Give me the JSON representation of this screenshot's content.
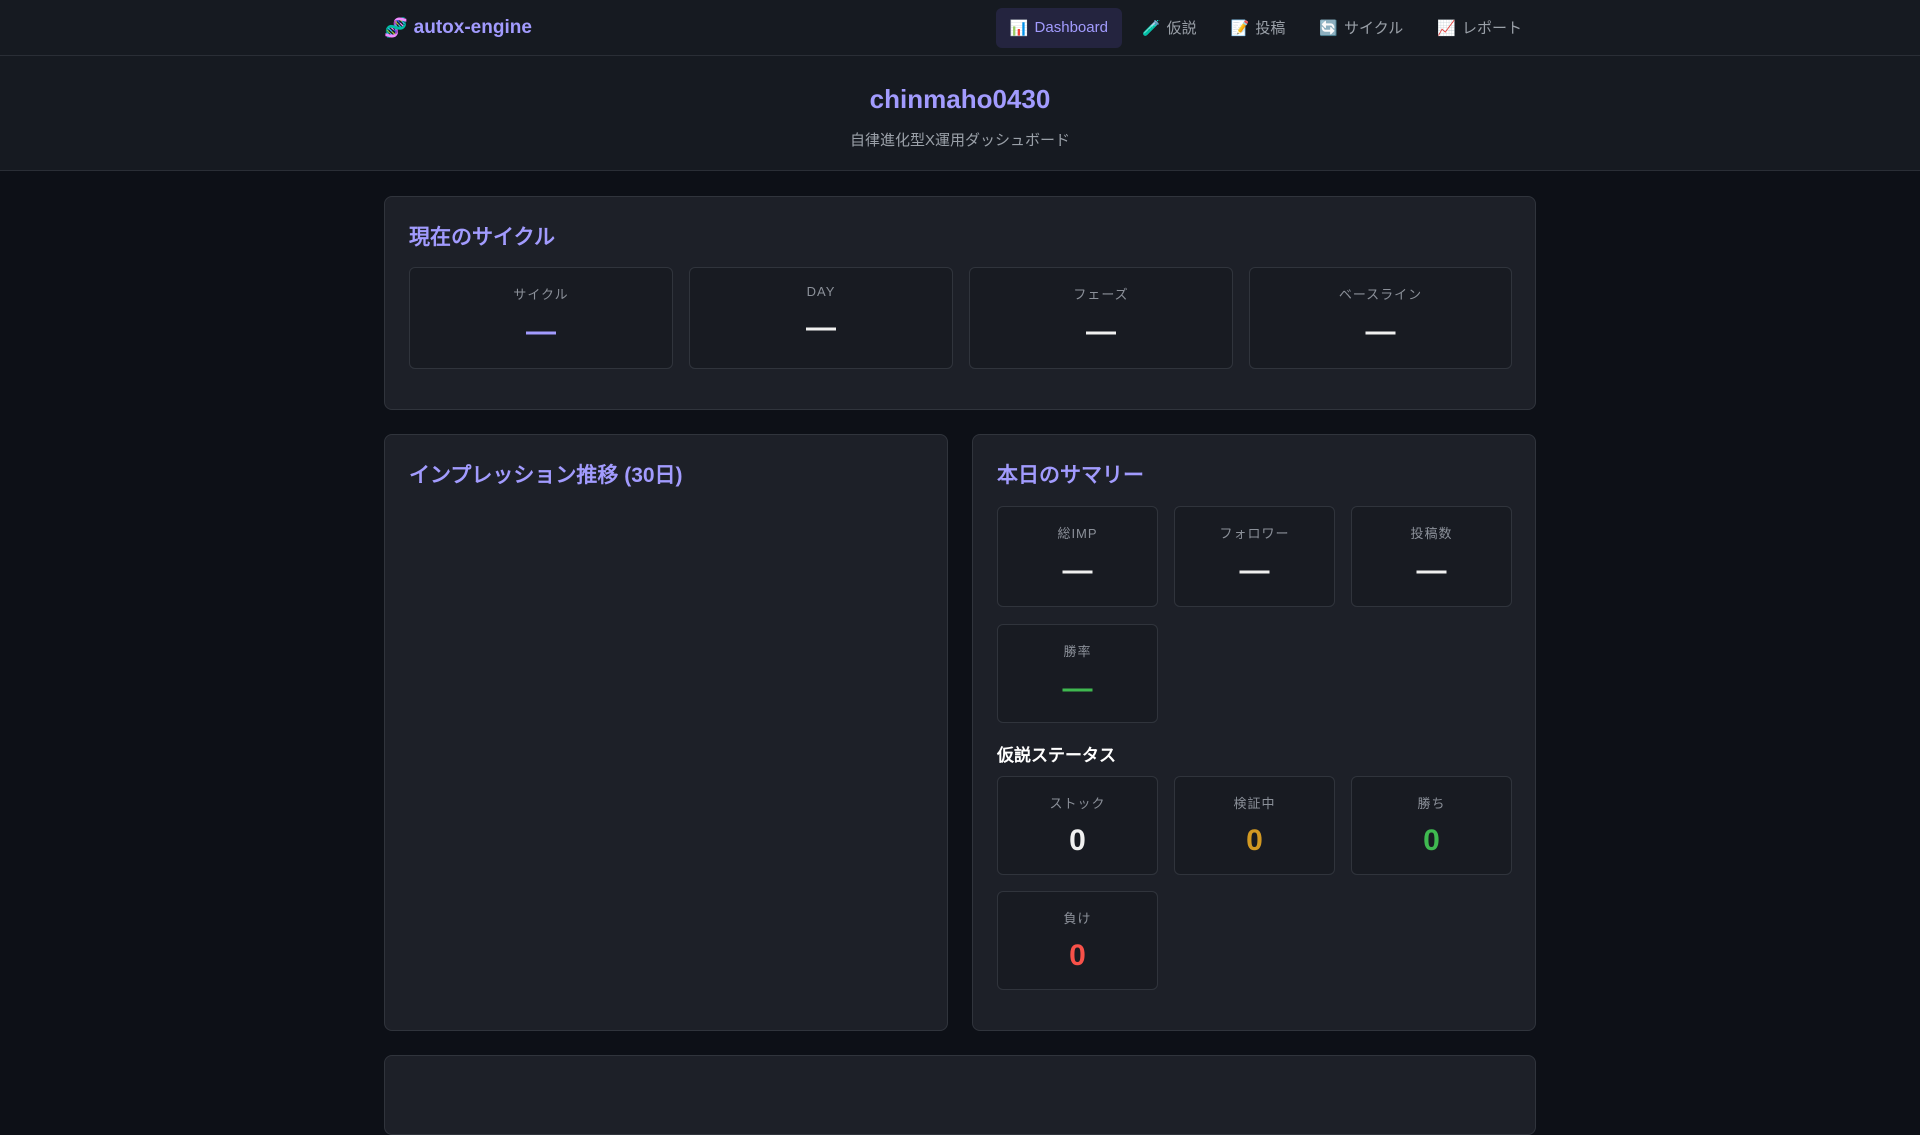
{
  "nav": {
    "logo": "autox-engine",
    "links": [
      {
        "icon": "📊",
        "label": "Dashboard"
      },
      {
        "icon": "🧪",
        "label": "仮説"
      },
      {
        "icon": "📝",
        "label": "投稿"
      },
      {
        "icon": "🔄",
        "label": "サイクル"
      },
      {
        "icon": "📈",
        "label": "レポート"
      }
    ]
  },
  "header": {
    "title": "chinmaho0430",
    "subtitle": "自律進化型X運用ダッシュボード"
  },
  "cycle": {
    "title": "現在のサイクル",
    "items": [
      {
        "label": "サイクル",
        "value": "—"
      },
      {
        "label": "DAY",
        "value": "—"
      },
      {
        "label": "フェーズ",
        "value": "—"
      },
      {
        "label": "ベースライン",
        "value": "—"
      }
    ]
  },
  "impressions": {
    "title": "インプレッション推移 (30日)"
  },
  "summary": {
    "title": "本日のサマリー",
    "items": [
      {
        "label": "総IMP",
        "value": "—"
      },
      {
        "label": "フォロワー",
        "value": "—"
      },
      {
        "label": "投稿数",
        "value": "—"
      },
      {
        "label": "勝率",
        "value": "—"
      }
    ],
    "status_title": "仮説ステータス",
    "status": [
      {
        "label": "ストック",
        "value": "0"
      },
      {
        "label": "検証中",
        "value": "0"
      },
      {
        "label": "勝ち",
        "value": "0"
      },
      {
        "label": "負け",
        "value": "0"
      }
    ]
  },
  "colors": {
    "accent": "#a29bfe",
    "green": "#3fb950",
    "orange": "#d29922",
    "red": "#f85149"
  }
}
